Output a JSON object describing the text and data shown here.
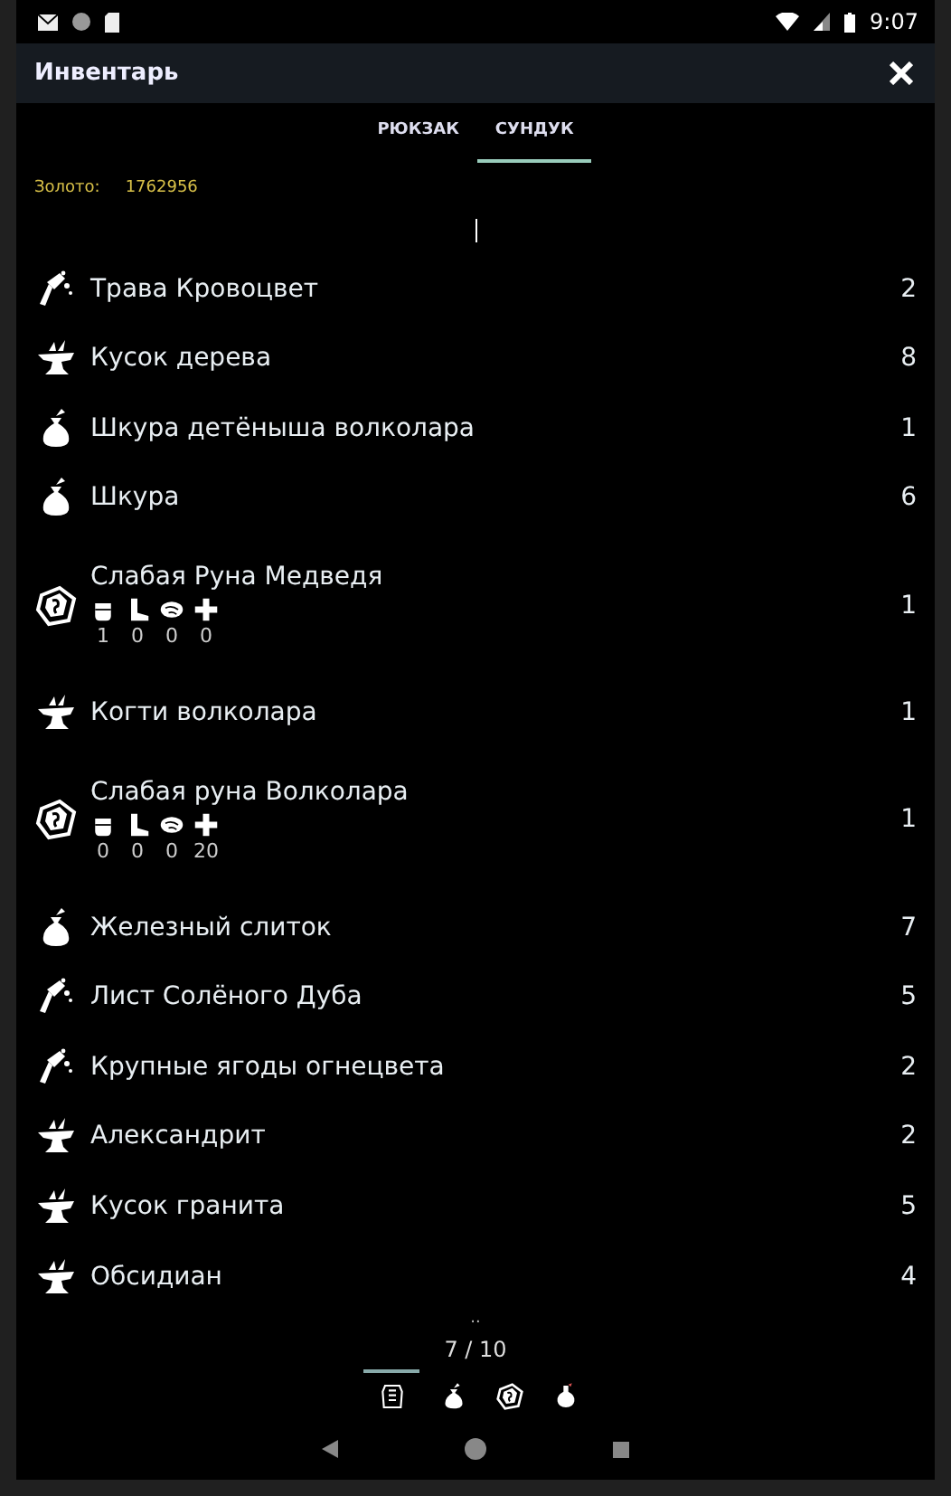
{
  "status_bar": {
    "time": "9:07"
  },
  "app_bar": {
    "title": "Инвентарь"
  },
  "tabs": [
    {
      "label": "РЮКЗАК",
      "selected": false
    },
    {
      "label": "СУНДУК",
      "selected": true
    }
  ],
  "gold": {
    "label": "Золото:",
    "value": "1762956"
  },
  "items": [
    {
      "kind": "herb",
      "name": "Трава Кровоцвет",
      "count": "2"
    },
    {
      "kind": "anvil",
      "name": "Кусок дерева",
      "count": "8"
    },
    {
      "kind": "bag",
      "name": "Шкура детёныша волколара",
      "count": "1"
    },
    {
      "kind": "bag",
      "name": "Шкура",
      "count": "6"
    },
    {
      "kind": "rune",
      "name": "Слабая Руна Медведя",
      "count": "1",
      "stats": [
        "1",
        "0",
        "0",
        "0"
      ]
    },
    {
      "kind": "anvil",
      "name": "Когти волколара",
      "count": "1"
    },
    {
      "kind": "rune",
      "name": "Слабая руна Волколара",
      "count": "1",
      "stats": [
        "0",
        "0",
        "0",
        "20"
      ]
    },
    {
      "kind": "bag",
      "name": "Железный слиток",
      "count": "7"
    },
    {
      "kind": "herb",
      "name": "Лист Солёного Дуба",
      "count": "5"
    },
    {
      "kind": "herb",
      "name": "Крупные ягоды огнецвета",
      "count": "2"
    },
    {
      "kind": "anvil",
      "name": "Александрит",
      "count": "2"
    },
    {
      "kind": "anvil",
      "name": "Кусок гранита",
      "count": "5"
    },
    {
      "kind": "anvil",
      "name": "Обсидиан",
      "count": "4"
    }
  ],
  "more_indicator": "..",
  "page": "7 / 10",
  "categories": [
    {
      "kind": "armor",
      "selected": true
    },
    {
      "kind": "bag",
      "selected": false
    },
    {
      "kind": "rune",
      "selected": false
    },
    {
      "kind": "potion",
      "selected": false
    }
  ]
}
